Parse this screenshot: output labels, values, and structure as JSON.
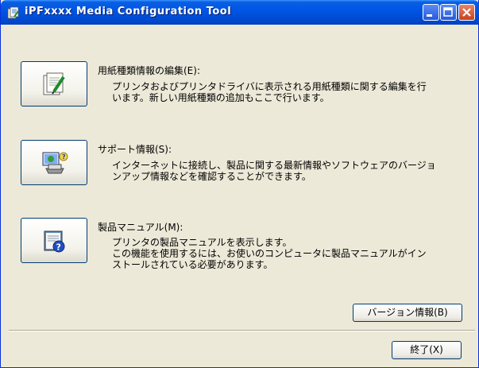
{
  "window": {
    "title": "iPFxxxx  Media Configuration Tool",
    "controls": [
      "minimize-icon",
      "maximize-icon",
      "close-icon"
    ]
  },
  "sections": [
    {
      "icon": "media-edit-icon",
      "heading": "用紙種類情報の編集(E):",
      "description": "プリンタおよびプリンタドライバに表示される用紙種類に関する編集を行\nいます。新しい用紙種類の追加もここで行います。"
    },
    {
      "icon": "support-info-icon",
      "heading": "サポート情報(S):",
      "description": "インターネットに接続し、製品に関する最新情報やソフトウェアのバージョ\nンアップ情報などを確認することができます。"
    },
    {
      "icon": "manual-help-icon",
      "heading": "製品マニュアル(M):",
      "description": "プリンタの製品マニュアルを表示します。\nこの機能を使用するには、お使いのコンピュータに製品マニュアルがイン\nストールされている必要があります。"
    }
  ],
  "buttons": {
    "version": "バージョン情報(B)",
    "exit": "終了(X)"
  },
  "colors": {
    "titlebar": "#0055e5",
    "dialog_bg": "#ece9d8",
    "button_border": "#003c74"
  }
}
